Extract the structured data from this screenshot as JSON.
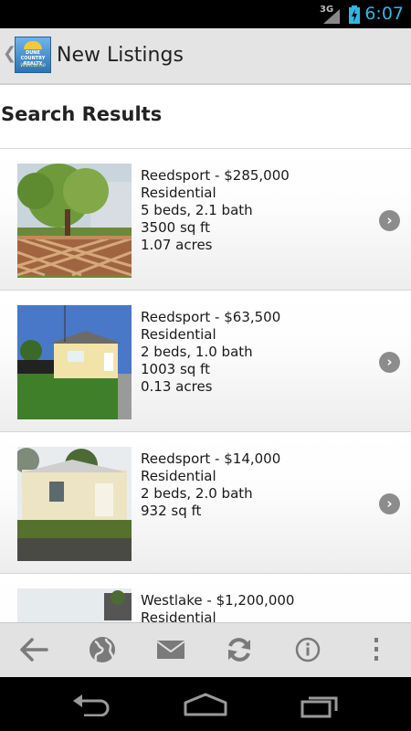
{
  "status": {
    "network": "3G",
    "time": "6:07"
  },
  "action_bar": {
    "title": "New Listings",
    "logo_text_top": "DUNE COUNTRY REALTY",
    "logo_text_bottom": "Welcome"
  },
  "heading": "Search Results",
  "listings": [
    {
      "title": "Reedsport - $285,000",
      "type": "Residential",
      "beds_baths": "5 beds, 2.1 bath",
      "sqft": "3500 sq ft",
      "acres": "1.07 acres"
    },
    {
      "title": "Reedsport - $63,500",
      "type": "Residential",
      "beds_baths": "2 beds, 1.0 bath",
      "sqft": "1003 sq ft",
      "acres": "0.13 acres"
    },
    {
      "title": "Reedsport - $14,000",
      "type": "Residential",
      "beds_baths": "2 beds, 2.0 bath",
      "sqft": "932 sq ft",
      "acres": ""
    },
    {
      "title": "Westlake - $1,200,000",
      "type": "Residential",
      "beds_baths": "",
      "sqft": "",
      "acres": ""
    }
  ],
  "toolbar_icons": [
    "back-arrow-icon",
    "globe-icon",
    "mail-icon",
    "refresh-icon",
    "info-icon",
    "overflow-menu-icon"
  ],
  "colors": {
    "accent": "#33b5e5",
    "toolbar": "#e2e2e2",
    "chevron": "#8c8c8c"
  }
}
